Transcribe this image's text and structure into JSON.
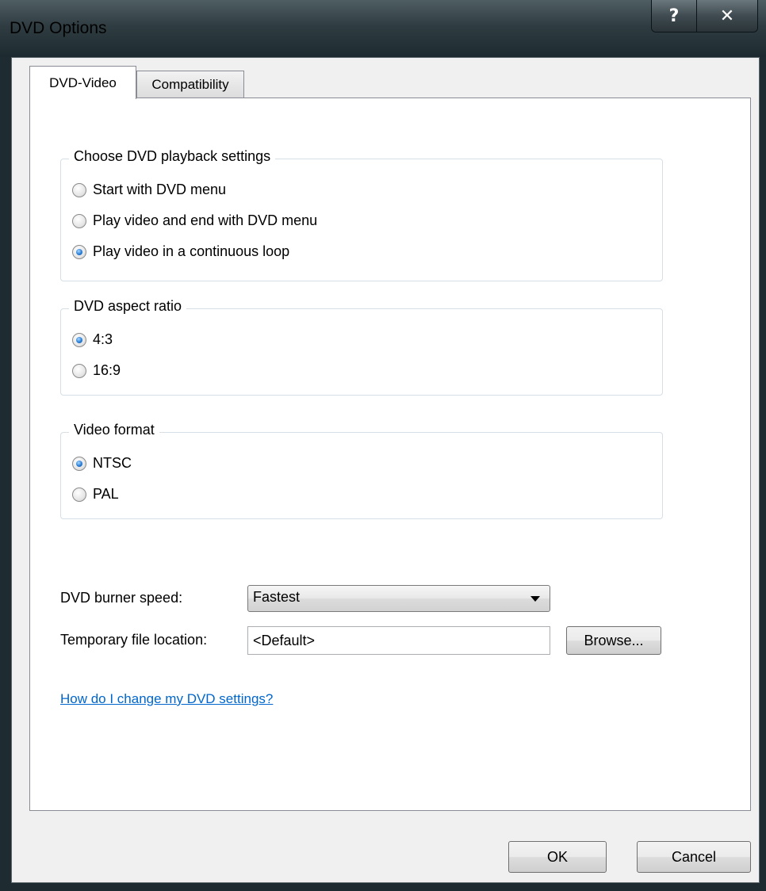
{
  "window": {
    "title": "DVD Options",
    "help_label": "?",
    "close_label": "✕"
  },
  "tabs": [
    {
      "label": "DVD-Video",
      "active": true
    },
    {
      "label": "Compatibility",
      "active": false
    }
  ],
  "playback": {
    "title": "Choose DVD playback settings",
    "options": [
      {
        "label": "Start with DVD menu",
        "checked": false
      },
      {
        "label": "Play video and end with DVD menu",
        "checked": false
      },
      {
        "label": "Play video in a continuous loop",
        "checked": true
      }
    ]
  },
  "aspect": {
    "title": "DVD aspect ratio",
    "options": [
      {
        "label": "4:3",
        "checked": true
      },
      {
        "label": "16:9",
        "checked": false
      }
    ]
  },
  "format": {
    "title": "Video format",
    "options": [
      {
        "label": "NTSC",
        "checked": true
      },
      {
        "label": "PAL",
        "checked": false
      }
    ]
  },
  "burner_speed": {
    "label": "DVD burner speed:",
    "value": "Fastest"
  },
  "temp_location": {
    "label": "Temporary file location:",
    "value": "<Default>",
    "browse_label": "Browse..."
  },
  "help_link": "How do I change my DVD settings?",
  "footer": {
    "ok_label": "OK",
    "cancel_label": "Cancel"
  }
}
